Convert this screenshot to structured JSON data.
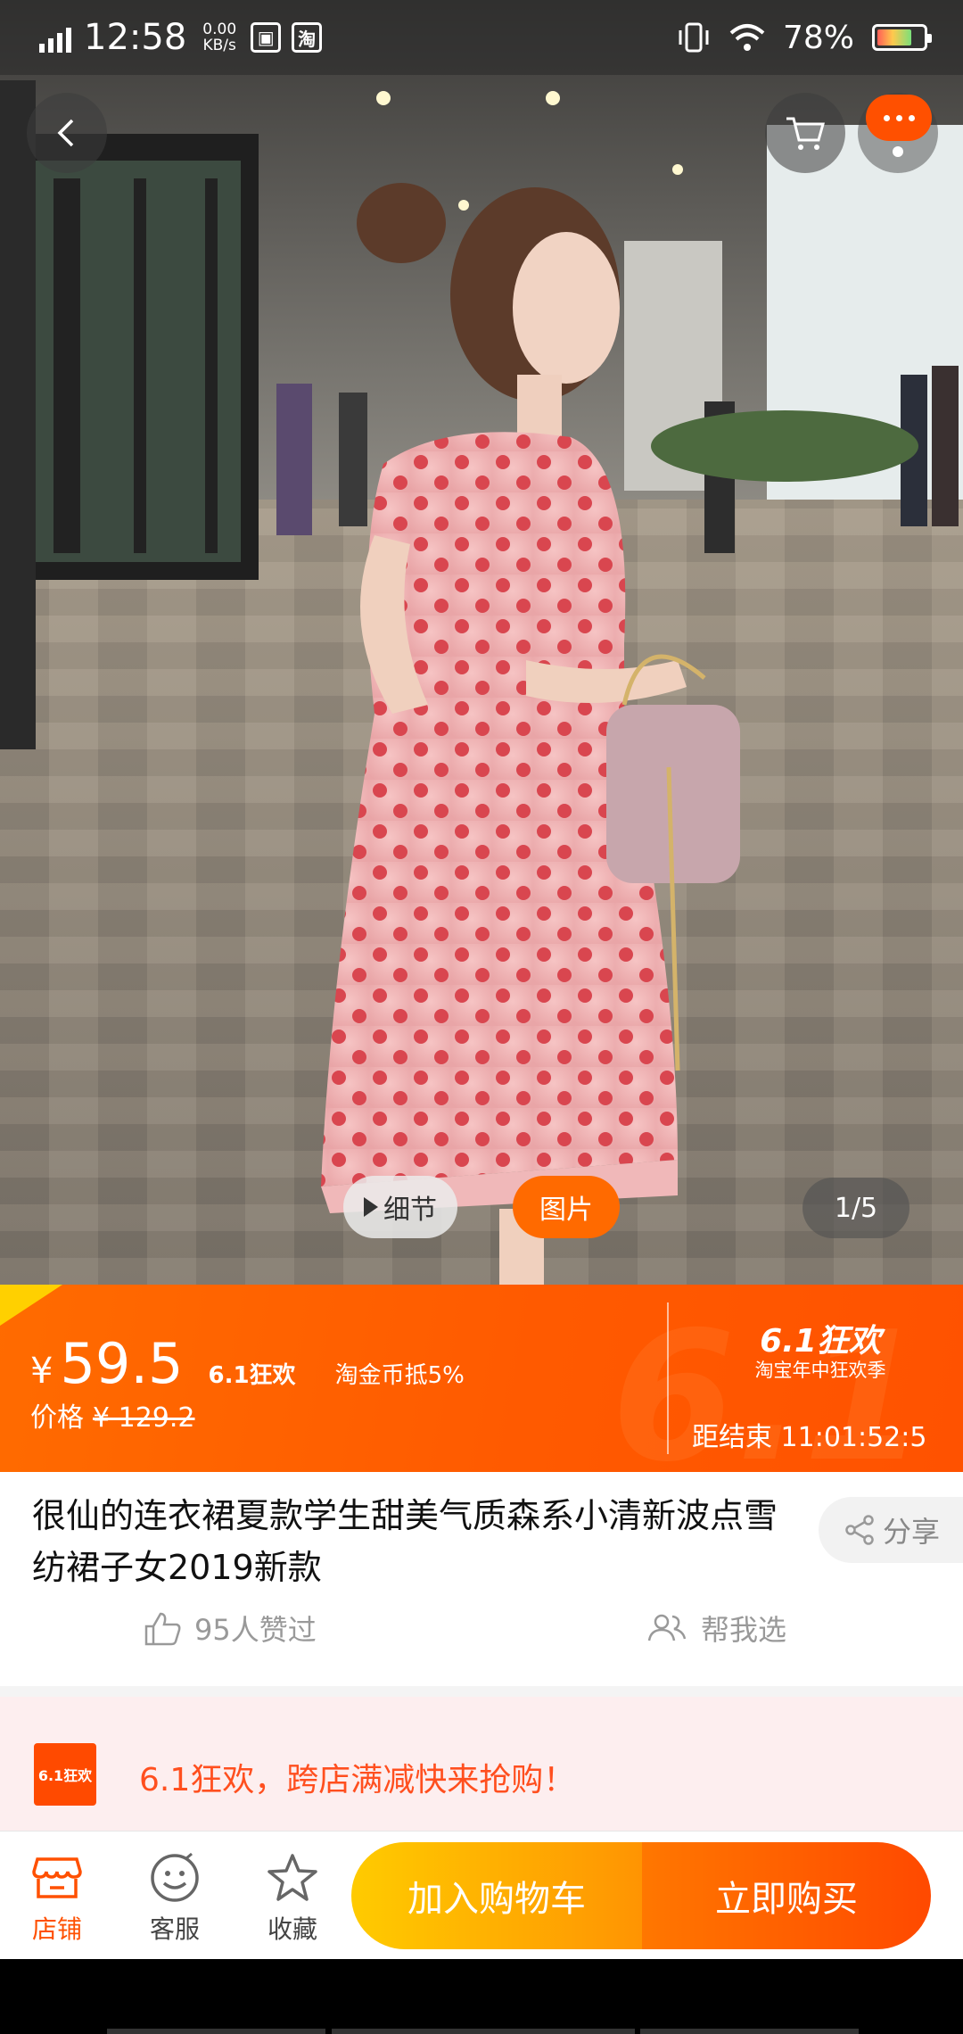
{
  "status_bar": {
    "network": "G",
    "time": "12:58",
    "speed_value": "0.00",
    "speed_unit": "KB/s",
    "battery_percent": "78%",
    "battery_level": 0.78
  },
  "media": {
    "detail_label": "细节",
    "image_label": "图片",
    "page_indicator": "1/5"
  },
  "price": {
    "currency": "¥",
    "current": "59.5",
    "promo_tag": "6.1狂欢",
    "coin_tag": "淘金币抵5%",
    "original_label": "价格",
    "original": "¥ 129.2"
  },
  "event": {
    "title": "6.1狂欢",
    "subtitle": "淘宝年中狂欢季",
    "countdown": "距结束 11:01:52:5"
  },
  "product": {
    "title": "很仙的连衣裙夏款学生甜美气质森系小清新波点雪纺裙子女2019新款",
    "share_label": "分享",
    "likes_label": "95人赞过",
    "pick_label": "帮我选"
  },
  "promo_banner": {
    "logo_text": "6.1狂欢",
    "text": "6.1狂欢，跨店满减快来抢购！"
  },
  "bottom_bar": {
    "shop_label": "店铺",
    "service_label": "客服",
    "favorite_label": "收藏",
    "add_to_cart_label": "加入购物车",
    "buy_now_label": "立即购买"
  },
  "colors": {
    "brand_orange": "#ff5000",
    "cart_yellow": "#ffcb00",
    "promo_text": "#ff4f1f"
  },
  "icons": [
    "back-icon",
    "cart-icon",
    "more-icon",
    "play-icon",
    "share-icon",
    "thumbs-up-icon",
    "people-icon",
    "shop-icon",
    "service-icon",
    "star-icon"
  ]
}
